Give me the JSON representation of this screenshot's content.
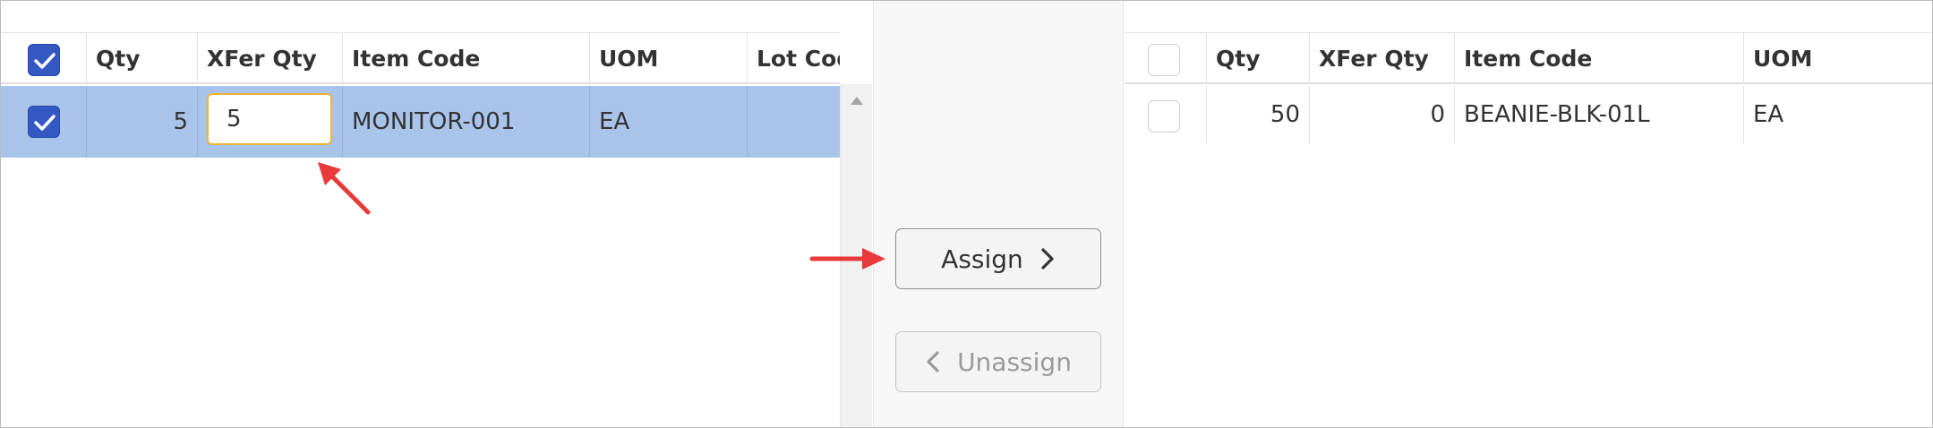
{
  "left_grid": {
    "columns": [
      "Qty",
      "XFer Qty",
      "Item Code",
      "UOM",
      "Lot Cod"
    ],
    "header_checkbox_checked": true,
    "rows": [
      {
        "selected": true,
        "checked": true,
        "qty": "5",
        "xfer_qty": "5",
        "item_code": "MONITOR-001",
        "uom": "EA",
        "lot_code": ""
      }
    ]
  },
  "right_grid": {
    "columns": [
      "Qty",
      "XFer Qty",
      "Item Code",
      "UOM"
    ],
    "header_checkbox_checked": false,
    "rows": [
      {
        "selected": false,
        "checked": false,
        "qty": "50",
        "xfer_qty": "0",
        "item_code": "BEANIE-BLK-01L",
        "uom": "EA"
      }
    ]
  },
  "actions": {
    "assign_label": "Assign",
    "unassign_label": "Unassign",
    "assign_enabled": true,
    "unassign_enabled": false
  },
  "icons": {
    "checkbox_check": "check-icon",
    "assign": "chevron-right-icon",
    "unassign": "chevron-left-icon",
    "scroll_up": "arrow-up-icon",
    "annotation": "red-arrow-icon"
  },
  "colors": {
    "selected_row": "#a9c4ea",
    "checkbox_checked": "#3358c4",
    "input_focus_border": "#f0b436",
    "annotation_arrow": "#e83a3a"
  }
}
